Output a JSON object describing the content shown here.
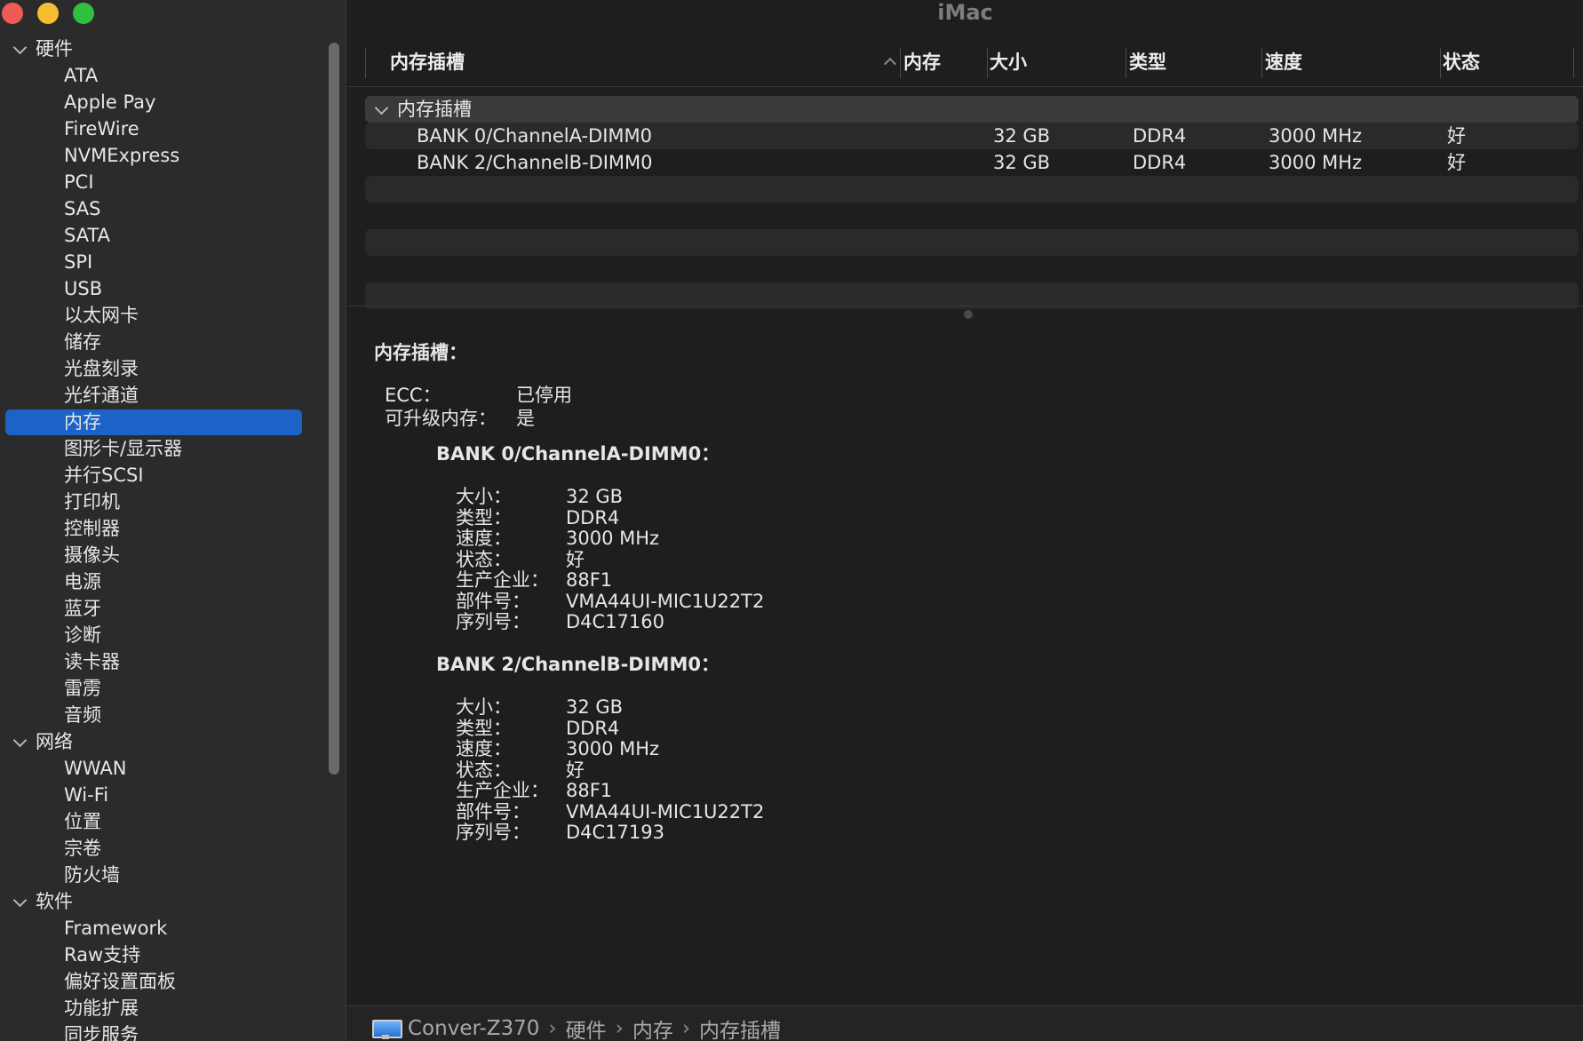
{
  "window": {
    "title": "iMac"
  },
  "sidebar": {
    "groups": [
      {
        "label": "硬件",
        "items": [
          "ATA",
          "Apple Pay",
          "FireWire",
          "NVMExpress",
          "PCI",
          "SAS",
          "SATA",
          "SPI",
          "USB",
          "以太网卡",
          "储存",
          "光盘刻录",
          "光纤通道",
          "内存",
          "图形卡/显示器",
          "并行SCSI",
          "打印机",
          "控制器",
          "摄像头",
          "电源",
          "蓝牙",
          "诊断",
          "读卡器",
          "雷雳",
          "音频"
        ]
      },
      {
        "label": "网络",
        "items": [
          "WWAN",
          "Wi-Fi",
          "位置",
          "宗卷",
          "防火墙"
        ]
      },
      {
        "label": "软件",
        "items": [
          "Framework",
          "Raw支持",
          "偏好设置面板",
          "功能扩展",
          "同步服务"
        ]
      }
    ],
    "selected": "内存"
  },
  "table": {
    "columns": [
      "内存插槽",
      "内存",
      "大小",
      "类型",
      "速度",
      "状态"
    ],
    "group_label": "内存插槽",
    "rows": [
      {
        "slot": "BANK 0/ChannelA-DIMM0",
        "size": "32 GB",
        "type": "DDR4",
        "speed": "3000 MHz",
        "status": "好"
      },
      {
        "slot": "BANK 2/ChannelB-DIMM0",
        "size": "32 GB",
        "type": "DDR4",
        "speed": "3000 MHz",
        "status": "好"
      }
    ]
  },
  "detail": {
    "heading": "内存插槽：",
    "ecc_label": "ECC：",
    "ecc_value": "已停用",
    "upgradable_label": "可升级内存：",
    "upgradable_value": "是",
    "banks": [
      {
        "title": "BANK 0/ChannelA-DIMM0：",
        "size": "32 GB",
        "type": "DDR4",
        "speed": "3000 MHz",
        "status": "好",
        "manufacturer": "88F1",
        "part": "VMA44UI-MIC1U22T2",
        "serial": "D4C17160"
      },
      {
        "title": "BANK 2/ChannelB-DIMM0：",
        "size": "32 GB",
        "type": "DDR4",
        "speed": "3000 MHz",
        "status": "好",
        "manufacturer": "88F1",
        "part": "VMA44UI-MIC1U22T2",
        "serial": "D4C17193"
      }
    ],
    "labels": {
      "size": "大小：",
      "type": "类型：",
      "speed": "速度：",
      "status": "状态：",
      "manufacturer": "生产企业：",
      "part": "部件号：",
      "serial": "序列号："
    }
  },
  "breadcrumb": [
    "Conver-Z370",
    "硬件",
    "内存",
    "内存插槽"
  ],
  "colors": {
    "selection": "#1d63c7",
    "background": "#1e1e1e",
    "sidebar": "#2b2b2b"
  }
}
